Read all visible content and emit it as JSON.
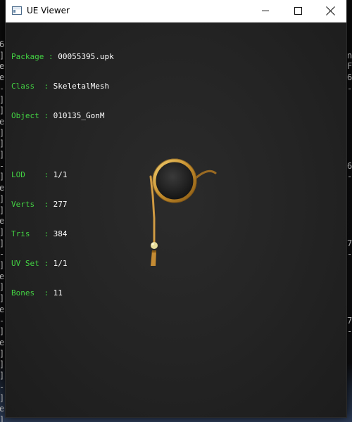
{
  "background_console": {
    "left_column": [
      "6",
      "]",
      "e",
      "e",
      "-",
      "]",
      "]",
      "e",
      "]",
      "]",
      "]",
      "-",
      "]",
      "e",
      "]",
      "]",
      "e",
      "]",
      "]",
      "-",
      "]",
      "e",
      "]",
      "]",
      "e",
      "-",
      "]",
      "e",
      "]",
      "]",
      "]",
      "-",
      "]",
      "e",
      "]"
    ],
    "right_column": [
      "",
      "n",
      "F",
      "6",
      "-",
      "",
      "",
      "",
      "",
      "",
      "",
      "6",
      "-",
      "",
      "",
      "",
      "",
      "",
      "7",
      "-",
      "",
      "",
      "",
      "",
      "",
      "7",
      "-"
    ]
  },
  "window": {
    "title": "UE Viewer",
    "icon": "window-app-icon",
    "controls": {
      "minimize_icon": "minimize-icon",
      "maximize_icon": "maximize-icon",
      "close_icon": "close-icon"
    }
  },
  "viewport": {
    "background_color": "#242424",
    "label_color": "#43d243",
    "value_color": "#ffffff",
    "mesh_icon": "monocle-mesh",
    "info_block_1": [
      {
        "label": "Package",
        "value": "00055395.upk"
      },
      {
        "label": "Class  ",
        "value": "SkeletalMesh"
      },
      {
        "label": "Object ",
        "value": "010135_GonM"
      }
    ],
    "info_block_2": [
      {
        "label": "LOD    ",
        "value": "1/1"
      },
      {
        "label": "Verts  ",
        "value": "277"
      },
      {
        "label": "Tris   ",
        "value": "384"
      },
      {
        "label": "UV Set ",
        "value": "1/1"
      },
      {
        "label": "Bones  ",
        "value": "11"
      }
    ]
  }
}
